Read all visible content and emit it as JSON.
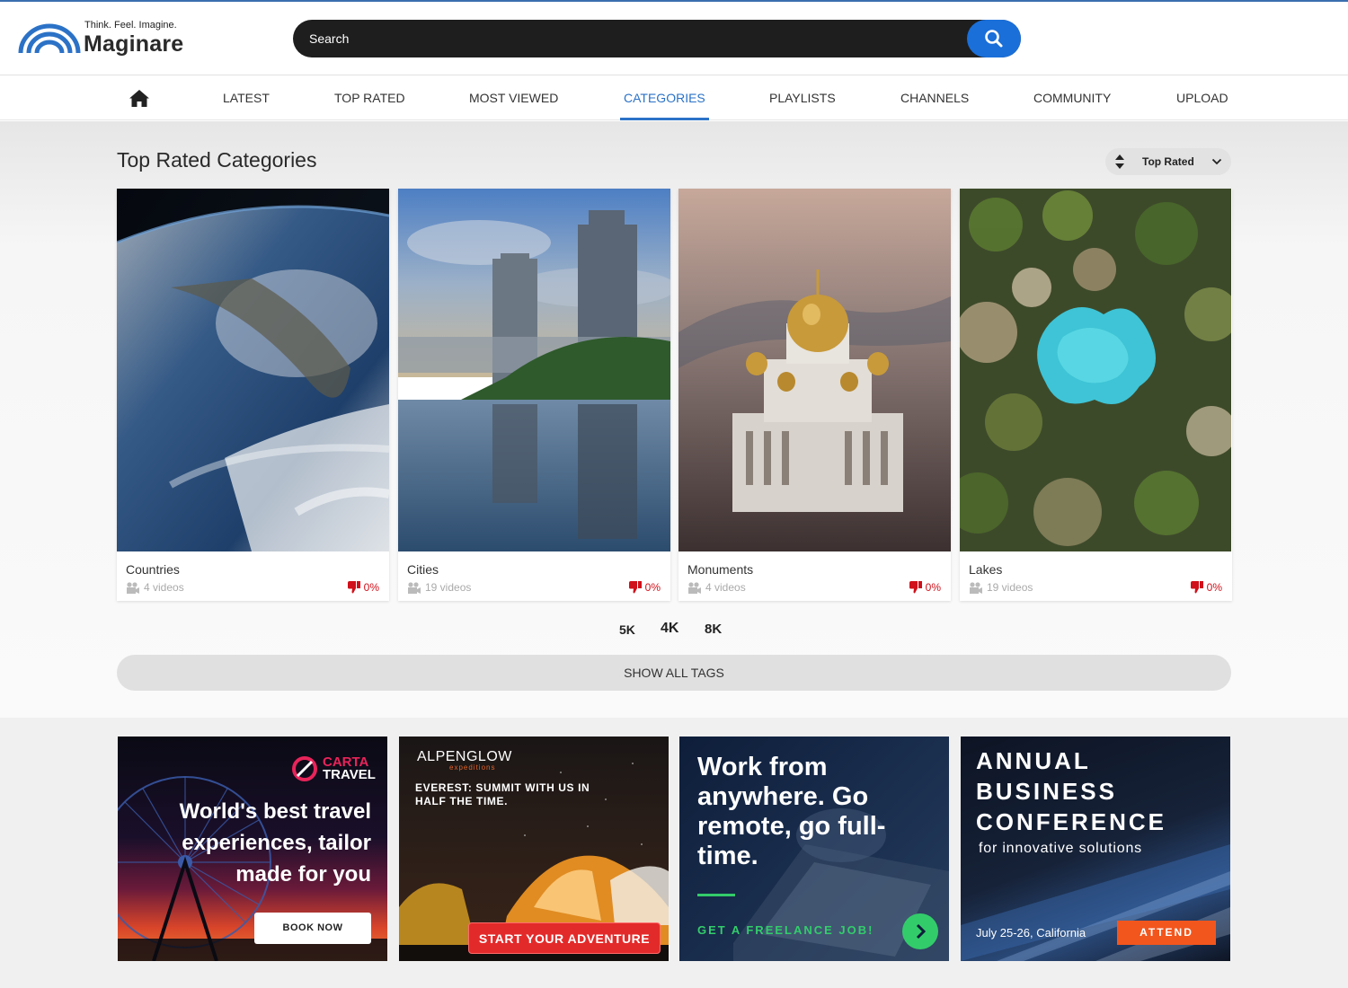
{
  "header": {
    "logo_tagline": "Think. Feel. Imagine.",
    "logo_brand": "Maginare",
    "search_placeholder": "Search"
  },
  "nav": {
    "items": [
      {
        "label": "LATEST"
      },
      {
        "label": "TOP RATED"
      },
      {
        "label": "MOST VIEWED"
      },
      {
        "label": "CATEGORIES",
        "active": true
      },
      {
        "label": "PLAYLISTS"
      },
      {
        "label": "CHANNELS"
      },
      {
        "label": "COMMUNITY"
      },
      {
        "label": "UPLOAD"
      }
    ]
  },
  "main": {
    "title": "Top Rated Categories",
    "sort_label": "Top Rated",
    "categories": [
      {
        "name": "Countries",
        "videos": "4 videos",
        "rating": "0%"
      },
      {
        "name": "Cities",
        "videos": "19 videos",
        "rating": "0%"
      },
      {
        "name": "Monuments",
        "videos": "4 videos",
        "rating": "0%"
      },
      {
        "name": "Lakes",
        "videos": "19 videos",
        "rating": "0%"
      }
    ],
    "tags": [
      "5K",
      "4K",
      "8K"
    ],
    "show_all_tags": "SHOW ALL TAGS"
  },
  "ads": {
    "ad1": {
      "brand_line1": "CARTA",
      "brand_line2": "TRAVEL",
      "headline": "World's best travel experiences, tailor made for you",
      "cta": "BOOK NOW"
    },
    "ad2": {
      "brand": "ALPENGLOW",
      "brand_sub": "expeditions",
      "headline": "EVEREST: SUMMIT WITH US IN HALF THE TIME.",
      "cta": "START YOUR ADVENTURE"
    },
    "ad3": {
      "headline": "Work from anywhere. Go remote, go full-time.",
      "cta": "GET A FREELANCE JOB!"
    },
    "ad4": {
      "headline": "ANNUAL BUSINESS CONFERENCE",
      "subtitle": "for innovative solutions",
      "date": "July 25-26, California",
      "cta": "ATTEND"
    }
  },
  "colors": {
    "accent": "#2b72c7",
    "search_button": "#1a6fd9",
    "dislike_red": "#d0101a"
  }
}
